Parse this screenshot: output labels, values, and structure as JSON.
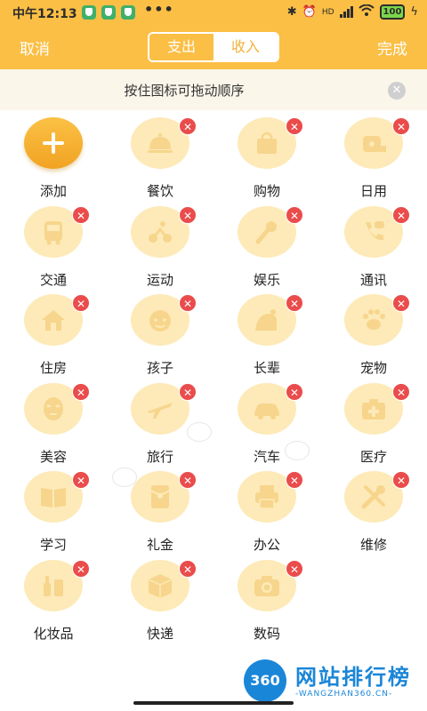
{
  "status_bar": {
    "time": "中午12:13",
    "dots": "•••",
    "battery": "100",
    "net": "HD"
  },
  "appbar": {
    "cancel_label": "取消",
    "done_label": "完成",
    "tabs": [
      "支出",
      "收入"
    ],
    "selected_tab": "支出"
  },
  "hint": {
    "text": "按住图标可拖动顺序",
    "close": "✕"
  },
  "categories": [
    {
      "label": "添加",
      "icon": "plus-icon"
    },
    {
      "label": "餐饮",
      "icon": "cloche-icon"
    },
    {
      "label": "购物",
      "icon": "shopping-bag-icon"
    },
    {
      "label": "日用",
      "icon": "tissue-roll-icon"
    },
    {
      "label": "交通",
      "icon": "bus-icon"
    },
    {
      "label": "运动",
      "icon": "cycling-icon"
    },
    {
      "label": "娱乐",
      "icon": "microphone-icon"
    },
    {
      "label": "通讯",
      "icon": "phone-icon"
    },
    {
      "label": "住房",
      "icon": "house-icon"
    },
    {
      "label": "孩子",
      "icon": "baby-icon"
    },
    {
      "label": "长辈",
      "icon": "elder-icon"
    },
    {
      "label": "宠物",
      "icon": "paw-icon"
    },
    {
      "label": "美容",
      "icon": "face-mask-icon"
    },
    {
      "label": "旅行",
      "icon": "airplane-icon"
    },
    {
      "label": "汽车",
      "icon": "car-icon"
    },
    {
      "label": "医疗",
      "icon": "medical-kit-icon"
    },
    {
      "label": "学习",
      "icon": "book-icon"
    },
    {
      "label": "礼金",
      "icon": "red-envelope-icon"
    },
    {
      "label": "办公",
      "icon": "printer-icon"
    },
    {
      "label": "维修",
      "icon": "tools-icon"
    },
    {
      "label": "化妆品",
      "icon": "cosmetics-icon"
    },
    {
      "label": "快递",
      "icon": "package-icon"
    },
    {
      "label": "数码",
      "icon": "camera-icon"
    }
  ],
  "delete_badge": "✕",
  "colors": {
    "primary": "#fbbf45",
    "icon_bg": "#fdeab8",
    "icon_fg": "#f7d58c",
    "delete": "#ea4c4c"
  },
  "watermark": {
    "logo": "360",
    "title": "网站排行榜",
    "subtitle": "-WANGZHAN360.CN-"
  }
}
